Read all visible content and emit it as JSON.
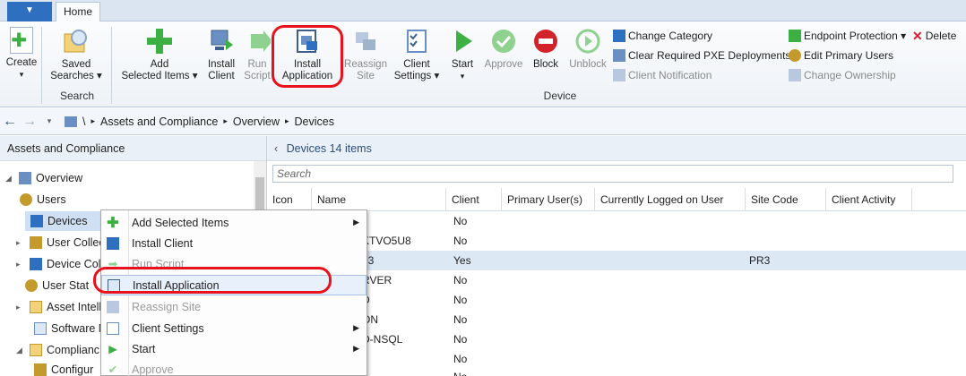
{
  "tabs": {
    "file": "▼",
    "home": "Home"
  },
  "ribbon": {
    "create": "Create",
    "saved_searches": [
      "Saved",
      "Searches ▾"
    ],
    "search_group": "Search",
    "add_selected": [
      "Add",
      "Selected Items ▾"
    ],
    "install_client": [
      "Install",
      "Client"
    ],
    "run_script": [
      "Run",
      "Script"
    ],
    "install_application": [
      "Install",
      "Application"
    ],
    "reassign_site": [
      "Reassign",
      "Site"
    ],
    "client_settings": [
      "Client",
      "Settings ▾"
    ],
    "start": [
      "Start",
      "▾"
    ],
    "approve": "Approve",
    "block": "Block",
    "unblock": "Unblock",
    "device_group": "Device",
    "change_category": "Change Category",
    "clear_pxe": "Clear Required PXE Deployments",
    "client_notification": "Client Notification",
    "endpoint_protection": "Endpoint Protection ▾",
    "delete": "Delete",
    "edit_primary_users": "Edit Primary Users",
    "change_ownership": "Change Ownership"
  },
  "address": {
    "root": "\\",
    "crumbs": [
      "Assets and Compliance",
      "Overview",
      "Devices"
    ]
  },
  "left": {
    "title": "Assets and Compliance",
    "items": [
      "Overview",
      "Users",
      "Devices",
      "User Collec",
      "Device Coll",
      "User Stat",
      "Asset Intell",
      "Software M",
      "Complianc",
      "Configur"
    ]
  },
  "right": {
    "title": "Devices 14 items",
    "search_placeholder": "Search",
    "columns": [
      "Icon",
      "Name",
      "Client",
      "Primary User(s)",
      "Currently Logged on User",
      "Site Code",
      "Client Activity"
    ],
    "rows": [
      {
        "name": "",
        "client": "No",
        "site": ""
      },
      {
        "name": "KTVO5U8",
        "client": "No",
        "site": ""
      },
      {
        "name": "03",
        "client": "Yes",
        "site": "PR3"
      },
      {
        "name": "RVER",
        "client": "No",
        "site": ""
      },
      {
        "name": "D",
        "client": "No",
        "site": ""
      },
      {
        "name": "ON",
        "client": "No",
        "site": ""
      },
      {
        "name": "D-NSQL",
        "client": "No",
        "site": ""
      },
      {
        "name": "",
        "client": "No",
        "site": ""
      },
      {
        "name": "",
        "client": "No",
        "site": ""
      }
    ]
  },
  "context_menu": [
    "Add Selected Items",
    "Install Client",
    "Run Script",
    "Install Application",
    "Reassign Site",
    "Client Settings",
    "Start",
    "Approve"
  ],
  "colors": {
    "highlight": "#e8121c",
    "green": "#3cb043",
    "blue": "#2f6fbf"
  }
}
